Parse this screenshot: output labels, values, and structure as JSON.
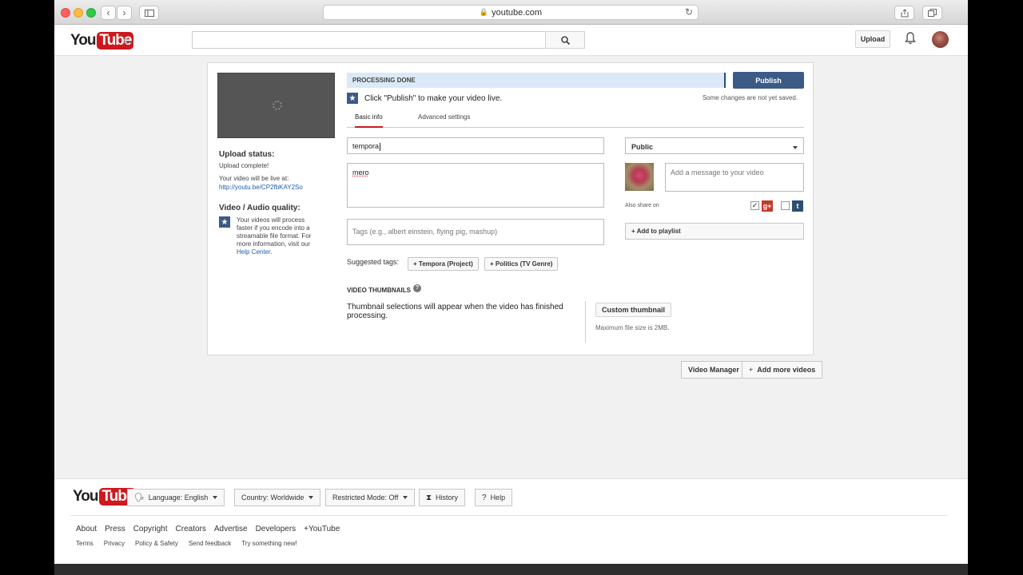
{
  "browser": {
    "url": "youtube.com"
  },
  "header": {
    "logo_you": "You",
    "logo_tube": "Tube",
    "search_value": "",
    "upload_label": "Upload"
  },
  "status": {
    "processing": "PROCESSING DONE",
    "publish_label": "Publish",
    "hint": "Click \"Publish\" to make your video live.",
    "unsaved": "Some changes are not yet saved."
  },
  "tabs": [
    {
      "label": "Basic info",
      "active": true
    },
    {
      "label": "Advanced settings",
      "active": false
    }
  ],
  "sidebar": {
    "upload_status_heading": "Upload status:",
    "upload_status": "Upload complete!",
    "live_at": "Your video will be live at:",
    "video_link": "http://youtu.be/CP2fbKAY2So",
    "quality_heading": "Video / Audio quality:",
    "quality_text_1": "Your videos will process",
    "quality_text_2": "faster if you encode into a",
    "quality_text_3": "streamable file format. For",
    "quality_text_4": "more information, visit our",
    "help_center": "Help Center."
  },
  "form": {
    "title_value": "tempora",
    "description_value": "mero",
    "tags_placeholder": "Tags (e.g., albert einstein, flying pig, mashup)",
    "privacy_value": "Public",
    "message_placeholder": "Add a message to your video",
    "also_share": "Also share on",
    "google_plus_checked": true,
    "twitter_checked": false,
    "playlist_label": "+ Add to playlist"
  },
  "suggested": {
    "label": "Suggested tags:",
    "tags": [
      "+ Tempora (Project)",
      "+ Politics (TV Genre)"
    ]
  },
  "thumbnails": {
    "heading": "VIDEO THUMBNAILS",
    "text": "Thumbnail selections will appear when the video has finished processing.",
    "custom_label": "Custom thumbnail",
    "max_size": "Maximum file size is 2MB."
  },
  "actions": {
    "video_manager": "Video Manager",
    "add_more": "Add more videos"
  },
  "footer": {
    "language": "Language: English",
    "country": "Country: Worldwide",
    "restricted": "Restricted Mode: Off",
    "history": "History",
    "help": "Help",
    "links": [
      "About",
      "Press",
      "Copyright",
      "Creators",
      "Advertise",
      "Developers",
      "+YouTube"
    ],
    "links2": [
      "Terms",
      "Privacy",
      "Policy & Safety",
      "Send feedback",
      "Try something new!"
    ]
  },
  "colors": {
    "brand_red": "#cc181e",
    "publish_blue": "#3b5a86",
    "processing_bg": "#dbe9f7",
    "link_blue": "#1f5ea8"
  }
}
